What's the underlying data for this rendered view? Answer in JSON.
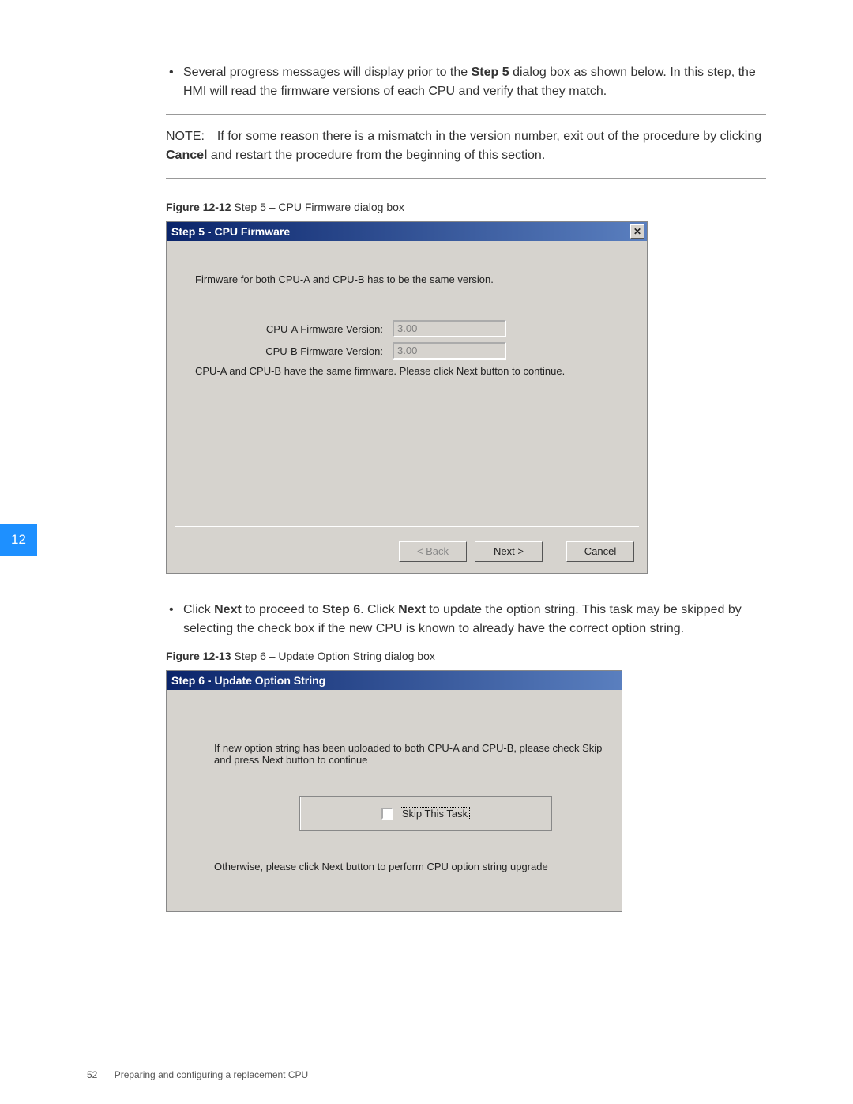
{
  "sideTab": "12",
  "bullet1": {
    "pre": "Several progress messages will display prior to the ",
    "bold": "Step 5",
    "post": " dialog box as shown below. In this step, the HMI will read the firmware versions of each CPU and verify that they match."
  },
  "note": {
    "lead": "NOTE: If for some reason there is a mismatch in the version number, exit out of the procedure by clicking ",
    "bold": "Cancel",
    "post": " and restart the procedure from the beginning of this section."
  },
  "fig1": {
    "num": "Figure 12-12",
    "desc": "  Step 5 – CPU Firmware dialog box"
  },
  "dialog1": {
    "title": "Step 5 - CPU Firmware",
    "close": "✕",
    "msg1": "Firmware for both CPU-A and CPU-B has to be the same version.",
    "labelA": "CPU-A Firmware Version:",
    "valueA": "3.00",
    "labelB": "CPU-B Firmware Version:",
    "valueB": "3.00",
    "msg2": "CPU-A and CPU-B have the same firmware. Please click Next button to continue.",
    "back": "< Back",
    "next": "Next >",
    "cancel": "Cancel"
  },
  "bullet2": {
    "p1": "Click ",
    "b1": "Next",
    "p2": " to proceed to ",
    "b2": "Step 6",
    "p3": ". Click ",
    "b3": "Next",
    "p4": " to update the option string. This task may be skipped by selecting the check box if the new CPU is known to already have the correct option string."
  },
  "fig2": {
    "num": "Figure 12-13",
    "desc": "  Step 6 – Update Option String dialog box"
  },
  "dialog2": {
    "title": "Step 6 - Update Option String",
    "msg1": "If new option string has been uploaded to both CPU-A and CPU-B, please check Skip and press Next button to continue",
    "skip": "Skip This Task",
    "msg2": "Otherwise, please click Next button to perform CPU option string upgrade"
  },
  "footer": {
    "pageNum": "52",
    "text": "Preparing and configuring a replacement CPU"
  }
}
